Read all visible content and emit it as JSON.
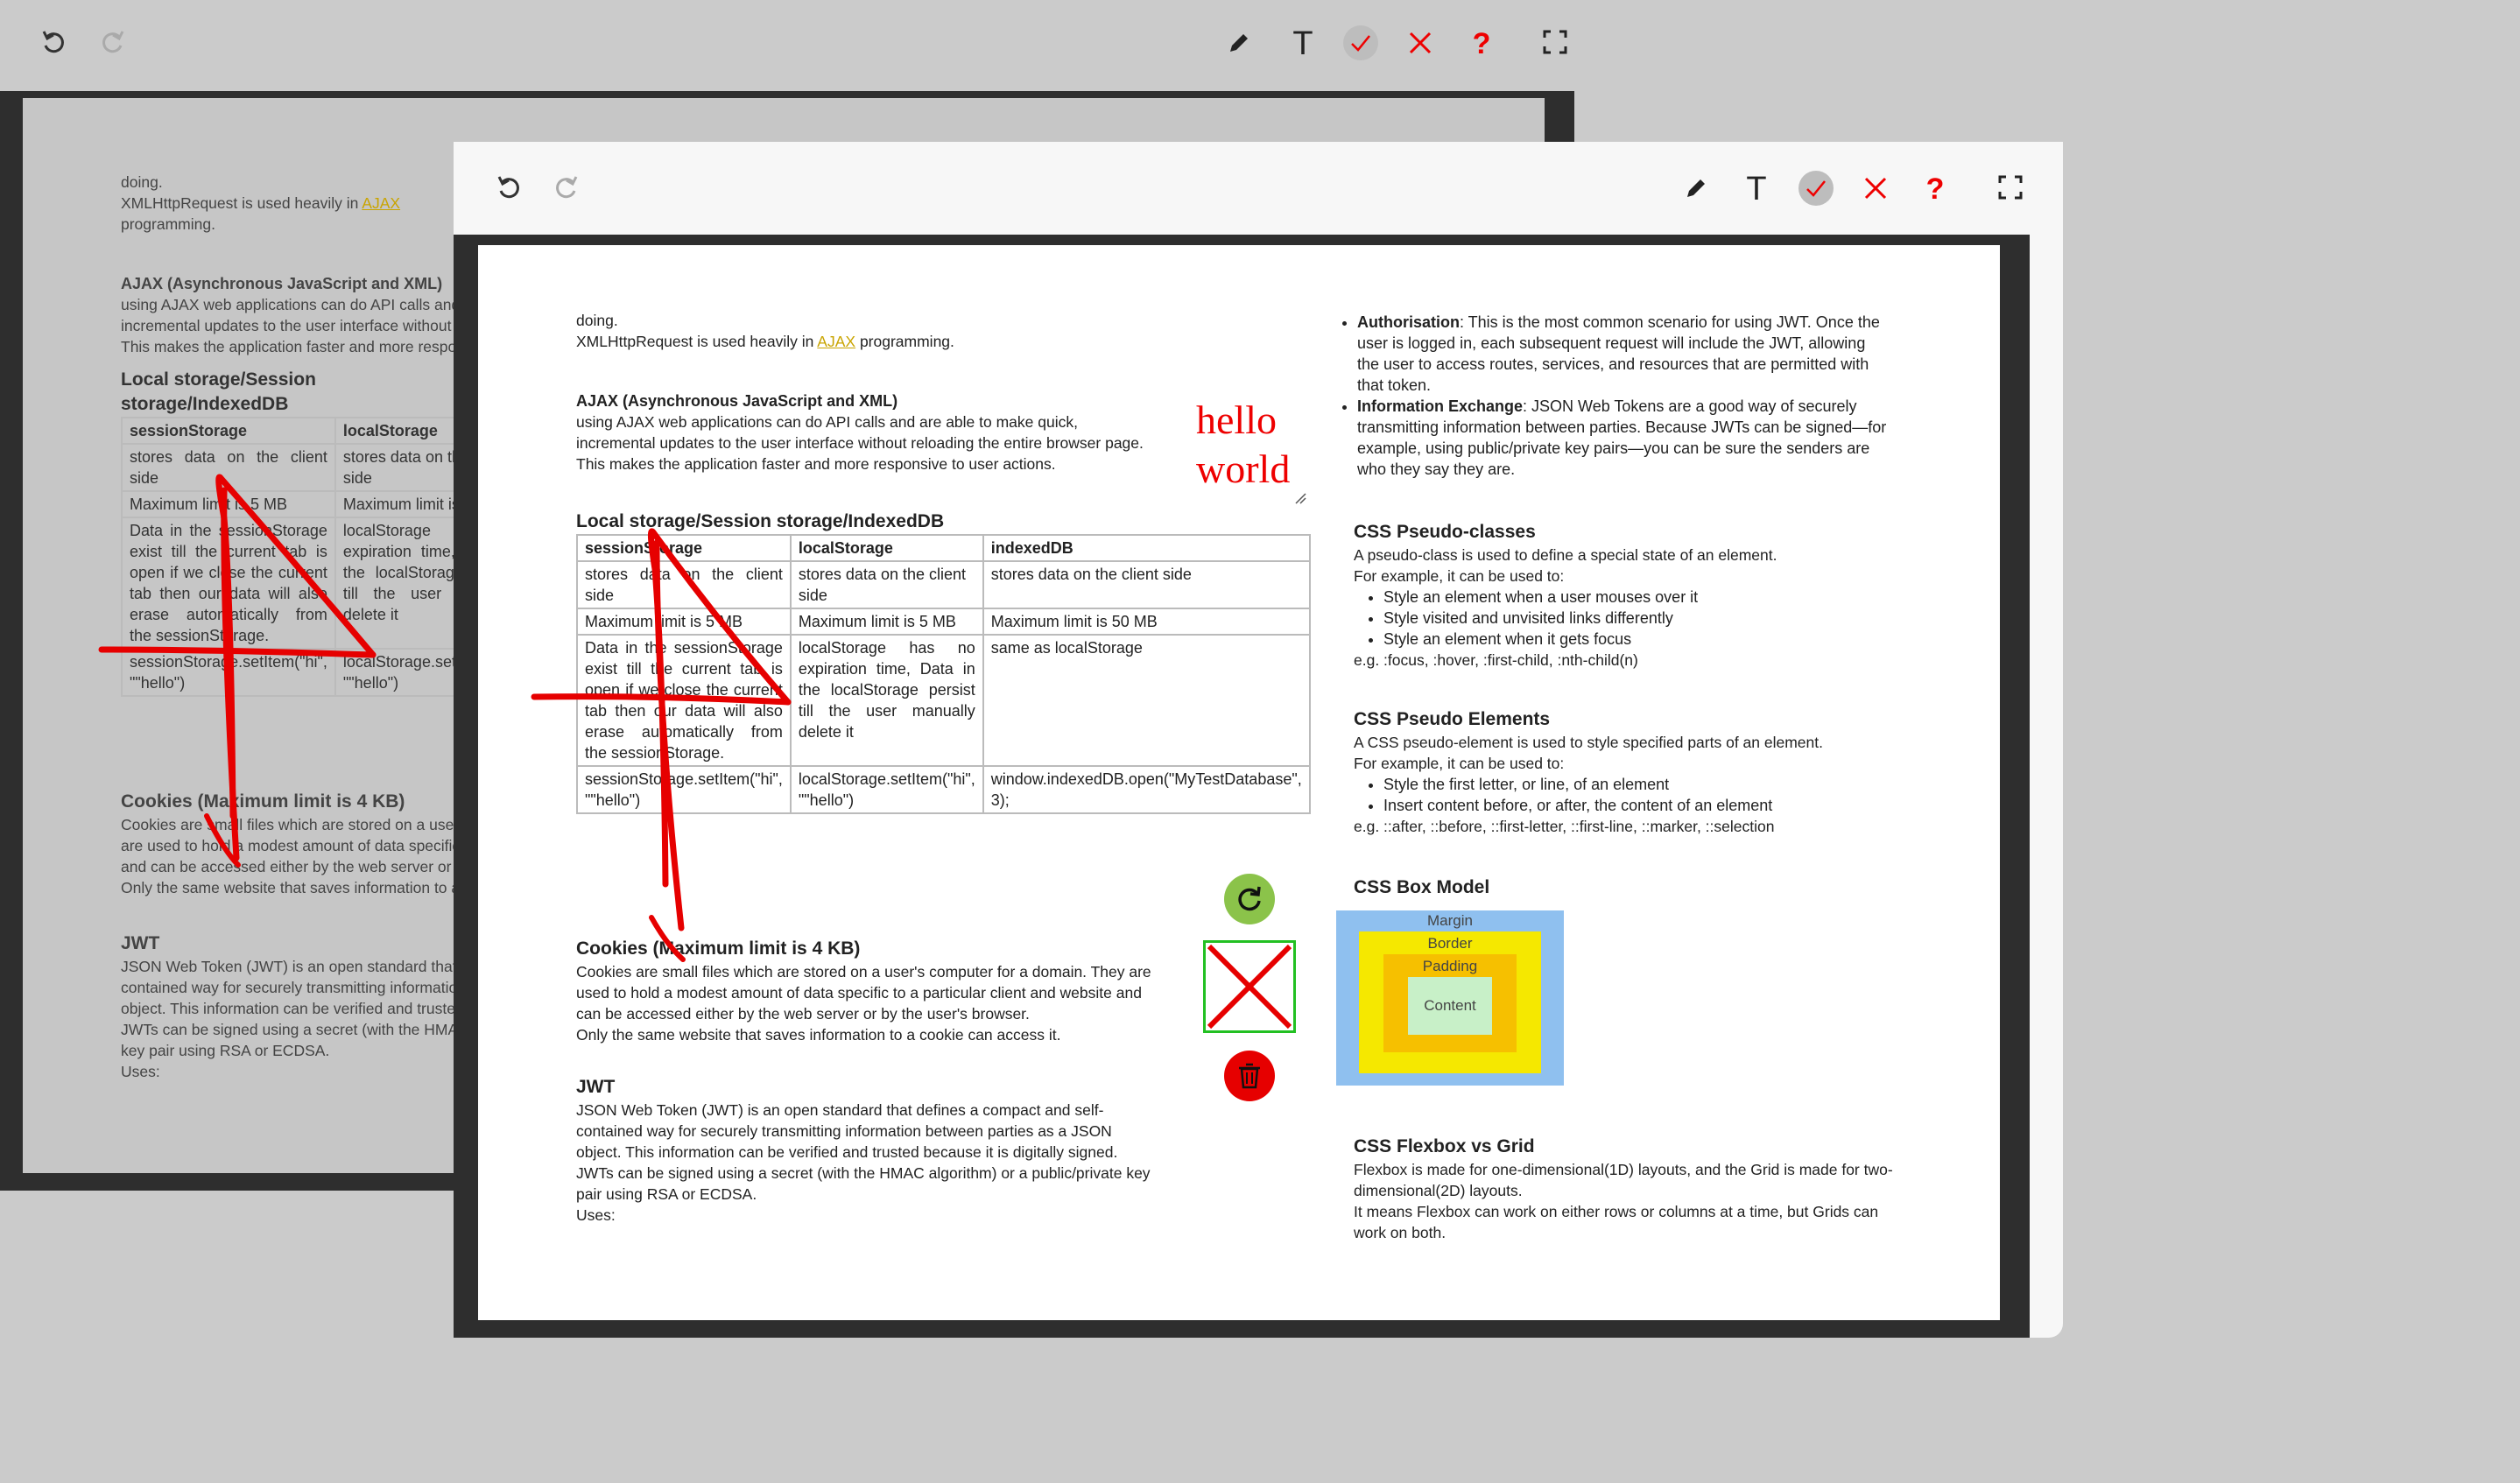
{
  "toolbar": {
    "undo_icon": "undo-icon",
    "redo_icon": "redo-icon",
    "pen_icon": "pencil-icon",
    "text_tool": "T",
    "check_icon": "check-icon",
    "close_icon": "close-icon",
    "help": "?",
    "fullscreen_icon": "fullscreen-icon"
  },
  "doc": {
    "intro_line1": "doing.",
    "intro_line2_prefix": "XMLHttpRequest is used heavily in ",
    "intro_link": "AJAX",
    "intro_line2_suffix": " programming.",
    "ajax_heading": "AJAX (Asynchronous JavaScript and XML)",
    "ajax_body": "using AJAX web applications can do API calls and are able to make quick, incremental updates to the user interface without reloading the entire browser page. This makes the application faster and more responsive to user actions.",
    "storage_heading": "Local storage/Session storage/IndexedDB",
    "table": {
      "headers": [
        "sessionStorage",
        "localStorage",
        "indexedDB"
      ],
      "rows": [
        [
          "stores data on the client side",
          "stores data on the client side",
          "stores data on the client side"
        ],
        [
          "Maximum limit is 5 MB",
          "Maximum limit is 5 MB",
          "Maximum limit is 50 MB"
        ],
        [
          "Data in the sessionStorage exist till the current tab is open if we close the current tab then our data will also erase automatically from the sessionStorage.",
          "localStorage has no expiration time, Data in the localStorage persist till the user manually delete it",
          "same as localStorage"
        ],
        [
          "sessionStorage.setItem(\"hi\", \"\"hello\")",
          "localStorage.setItem(\"hi\", \"\"hello\")",
          "window.indexedDB.open(\"MyTestDatabase\", 3);"
        ]
      ]
    },
    "cookies_heading": "Cookies (Maximum limit is 4 KB)",
    "cookies_body1": "Cookies are small files which are stored on a user's computer for a domain. They are used to hold a modest amount of data specific to a particular client and website and can be accessed either by the web server or by the user's browser.",
    "cookies_body2": "Only the same website that saves information to a cookie can access it.",
    "jwt_heading": "JWT",
    "jwt_body1": "JSON Web Token (JWT) is an open standard that defines a compact and self-contained way for securely transmitting information between parties as a JSON object. This information can be verified and trusted because it is digitally signed.",
    "jwt_body2": "JWTs can be signed using a secret (with the HMAC algorithm) or a public/private key pair using RSA or ECDSA.",
    "jwt_uses": "Uses:",
    "jwt_bullets": [
      {
        "term": "Authorisation",
        "text": ": This is the most common scenario for using JWT. Once the user is logged in, each subsequent request will include the JWT, allowing the user to access routes, services, and resources that are permitted with that token."
      },
      {
        "term": "Information Exchange",
        "text": ": JSON Web Tokens are a good way of securely transmitting information between parties. Because JWTs can be signed—for example, using public/private key pairs—you can be sure the senders are who they say they are."
      }
    ],
    "pseudo_classes_heading": "CSS Pseudo-classes",
    "pseudo_classes_body": "A pseudo-class is used to define a special state of an element.",
    "pseudo_classes_for": "For example, it can be used to:",
    "pseudo_classes_bullets": [
      "Style an element when a user mouses over it",
      "Style visited and unvisited links differently",
      "Style an element when it gets focus"
    ],
    "pseudo_classes_eg": "e.g. :focus, :hover, :first-child, :nth-child(n)",
    "pseudo_elements_heading": "CSS Pseudo Elements",
    "pseudo_elements_body": "A CSS pseudo-element is used to style specified parts of an element.",
    "pseudo_elements_for": "For example, it can be used to:",
    "pseudo_elements_bullets": [
      "Style the first letter, or line, of an element",
      "Insert content before, or after, the content of an element"
    ],
    "pseudo_elements_eg": "e.g. ::after, ::before, ::first-letter, ::first-line, ::marker,  ::selection",
    "box_model_heading": "CSS Box Model",
    "box_model": {
      "margin": "Margin",
      "border": "Border",
      "padding": "Padding",
      "content": "Content"
    },
    "flex_heading": "CSS Flexbox vs Grid",
    "flex_body1": "Flexbox is made for one-dimensional(1D) layouts, and the Grid is made for two-dimensional(2D) layouts.",
    "flex_body2": "It means Flexbox can work on either rows or columns at a time, but Grids can work on both."
  },
  "annotation": {
    "hello_text": "hello\nworld",
    "rotate_icon": "rotate-icon",
    "delete_icon": "trash-icon",
    "stroke_color": "#e60000"
  }
}
